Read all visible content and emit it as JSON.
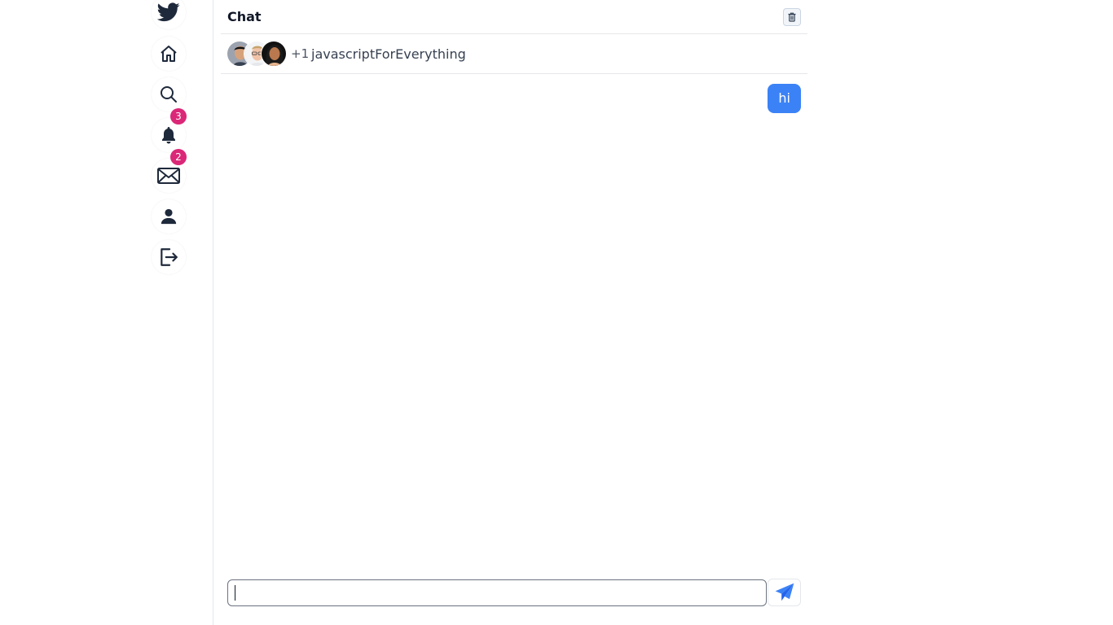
{
  "sidebar": {
    "items": [
      {
        "icon": "twitter-bird-icon"
      },
      {
        "icon": "home-icon"
      },
      {
        "icon": "search-icon"
      },
      {
        "icon": "bell-icon",
        "badge": "3"
      },
      {
        "icon": "mail-icon",
        "badge": "2"
      },
      {
        "icon": "user-icon"
      },
      {
        "icon": "logout-icon"
      }
    ]
  },
  "chat": {
    "title": "Chat",
    "participants": {
      "extra_count": "+1",
      "group_name": "javascriptForEverything"
    },
    "messages": [
      {
        "text": "hi",
        "from_self": true
      }
    ],
    "compose": {
      "value": "",
      "placeholder": ""
    }
  },
  "colors": {
    "accent": "#3b82f6",
    "badge": "#db2777",
    "icon": "#1f2937",
    "brand": "#1f2937"
  }
}
